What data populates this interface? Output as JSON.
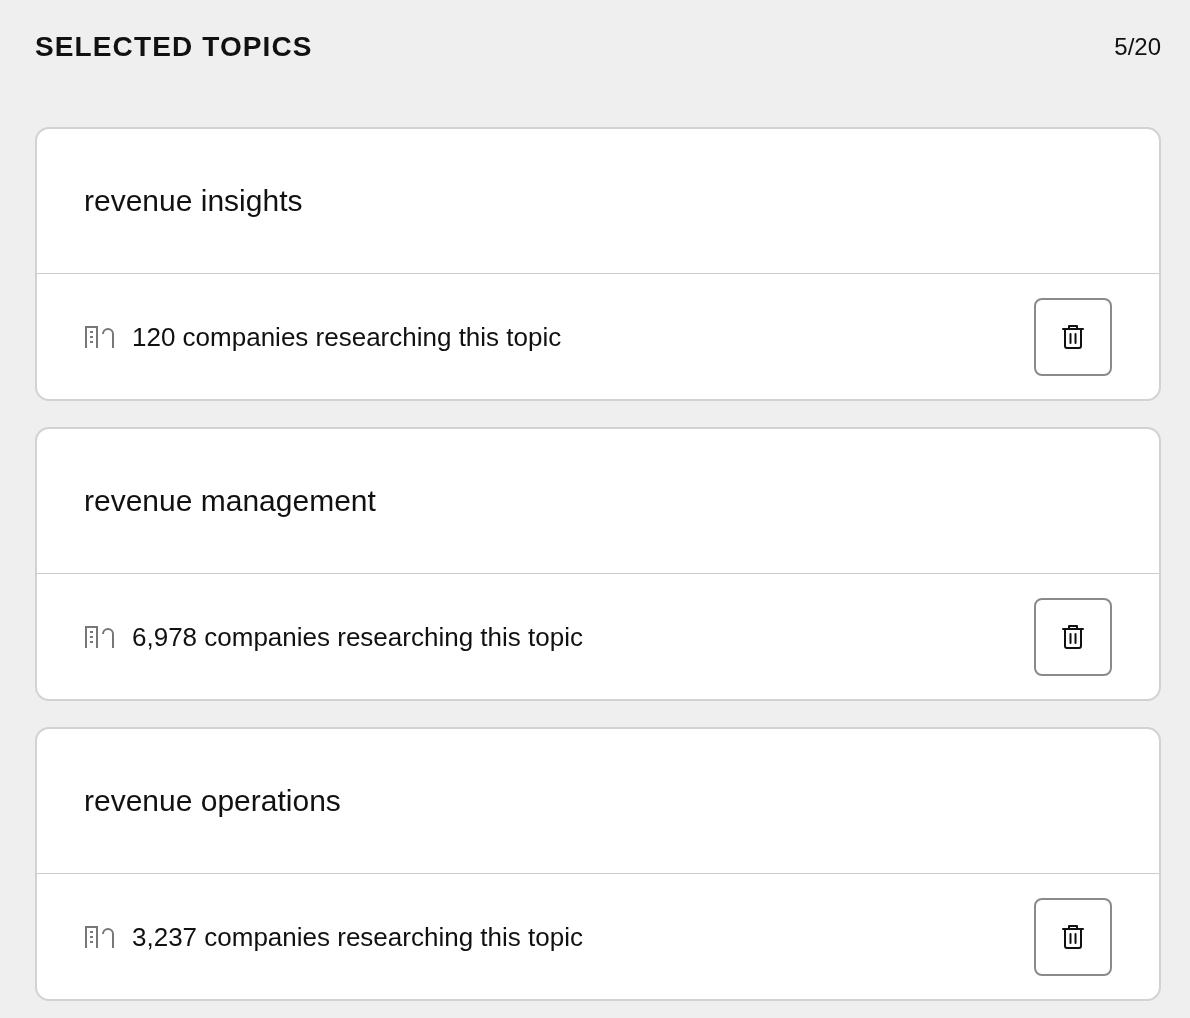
{
  "header": {
    "title": "SELECTED TOPICS",
    "count": "5/20"
  },
  "topics": [
    {
      "name": "revenue insights",
      "companies": "120 companies researching this topic"
    },
    {
      "name": "revenue management",
      "companies": "6,978 companies researching this topic"
    },
    {
      "name": "revenue operations",
      "companies": "3,237 companies researching this topic"
    }
  ]
}
